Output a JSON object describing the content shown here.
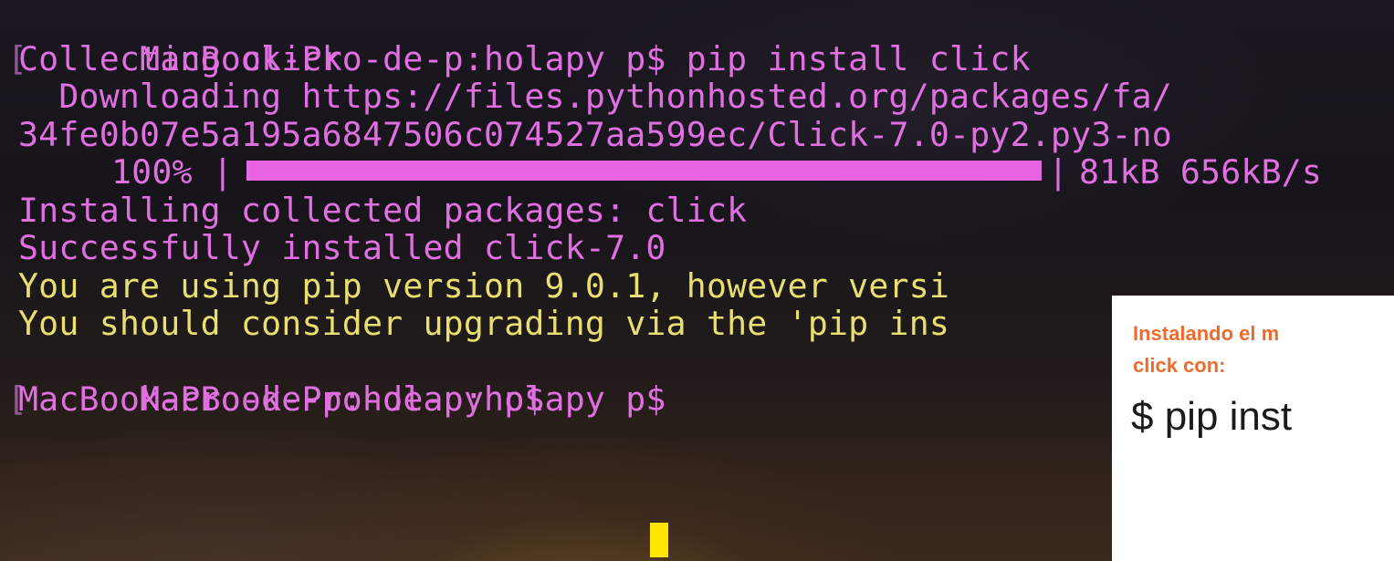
{
  "terminal": {
    "lines": [
      "MacBook-Pro-de-p:holapy p$ pip install click",
      "Collecting click",
      "  Downloading https://files.pythonhosted.org/packages/fa/",
      "34fe0b07e5a195a6847506c074527aa599ec/Click-7.0-py2.py3-no",
      "Installing collected packages: click",
      "Successfully installed click-7.0",
      "You are using pip version 9.0.1, however versi",
      "You should consider upgrading via the 'pip ins",
      "MacBook-Pro-de-p:holapy p$",
      "MacBook-Pro-de-p:holapy p$ "
    ],
    "progress": {
      "percent_label": "100% |",
      "bar_end": "|",
      "stats": "81kB 656kB/s",
      "fraction": 1.0
    },
    "colors": {
      "text": "#e070e0",
      "warning": "#e6e070",
      "progress_fill": "#e964e2",
      "cursor": "#ffe400"
    }
  },
  "note": {
    "title_line1": "Instalando el m",
    "title_line2": "click con:",
    "command": "$ pip inst",
    "colors": {
      "title": "#f06a2c",
      "command": "#1a1a1a",
      "background": "#ffffff"
    }
  }
}
